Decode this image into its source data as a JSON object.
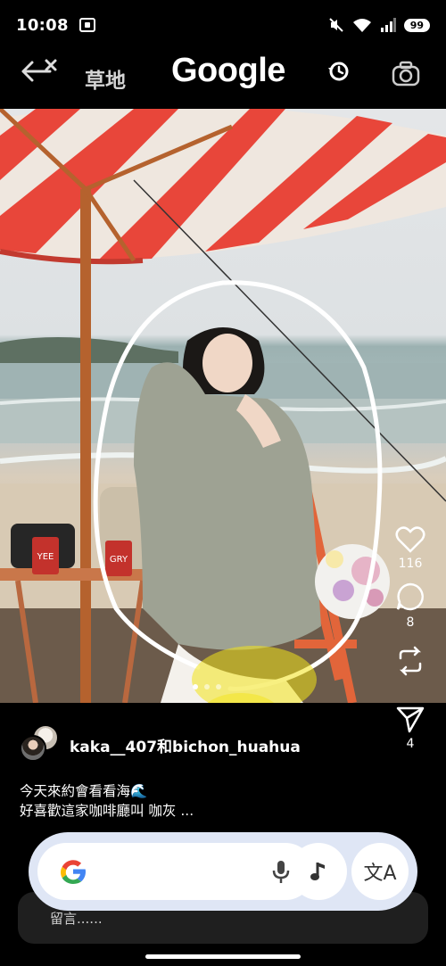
{
  "status": {
    "time": "10:08",
    "battery": "99"
  },
  "header": {
    "query": "草地",
    "logo": "Google"
  },
  "post": {
    "likes": "116",
    "comments": "8",
    "shares": "4",
    "authors": "kaka__407和bichon_huahua",
    "caption_line1": "今天來約會看看海🌊",
    "caption_line2": "好喜歡這家咖啡廳叫 咖灰 ...",
    "carousel_total": 3,
    "carousel_active": 1
  },
  "cups": {
    "left_text": "YEE",
    "right_text": "GRY"
  },
  "search": {
    "translate_icon": "文A"
  },
  "comment": {
    "placeholder": "留言......"
  },
  "colors": {
    "umbrella_red": "#e8463a",
    "lens_highlight": "#f3e31a",
    "search_bg": "#dfe6f5"
  }
}
